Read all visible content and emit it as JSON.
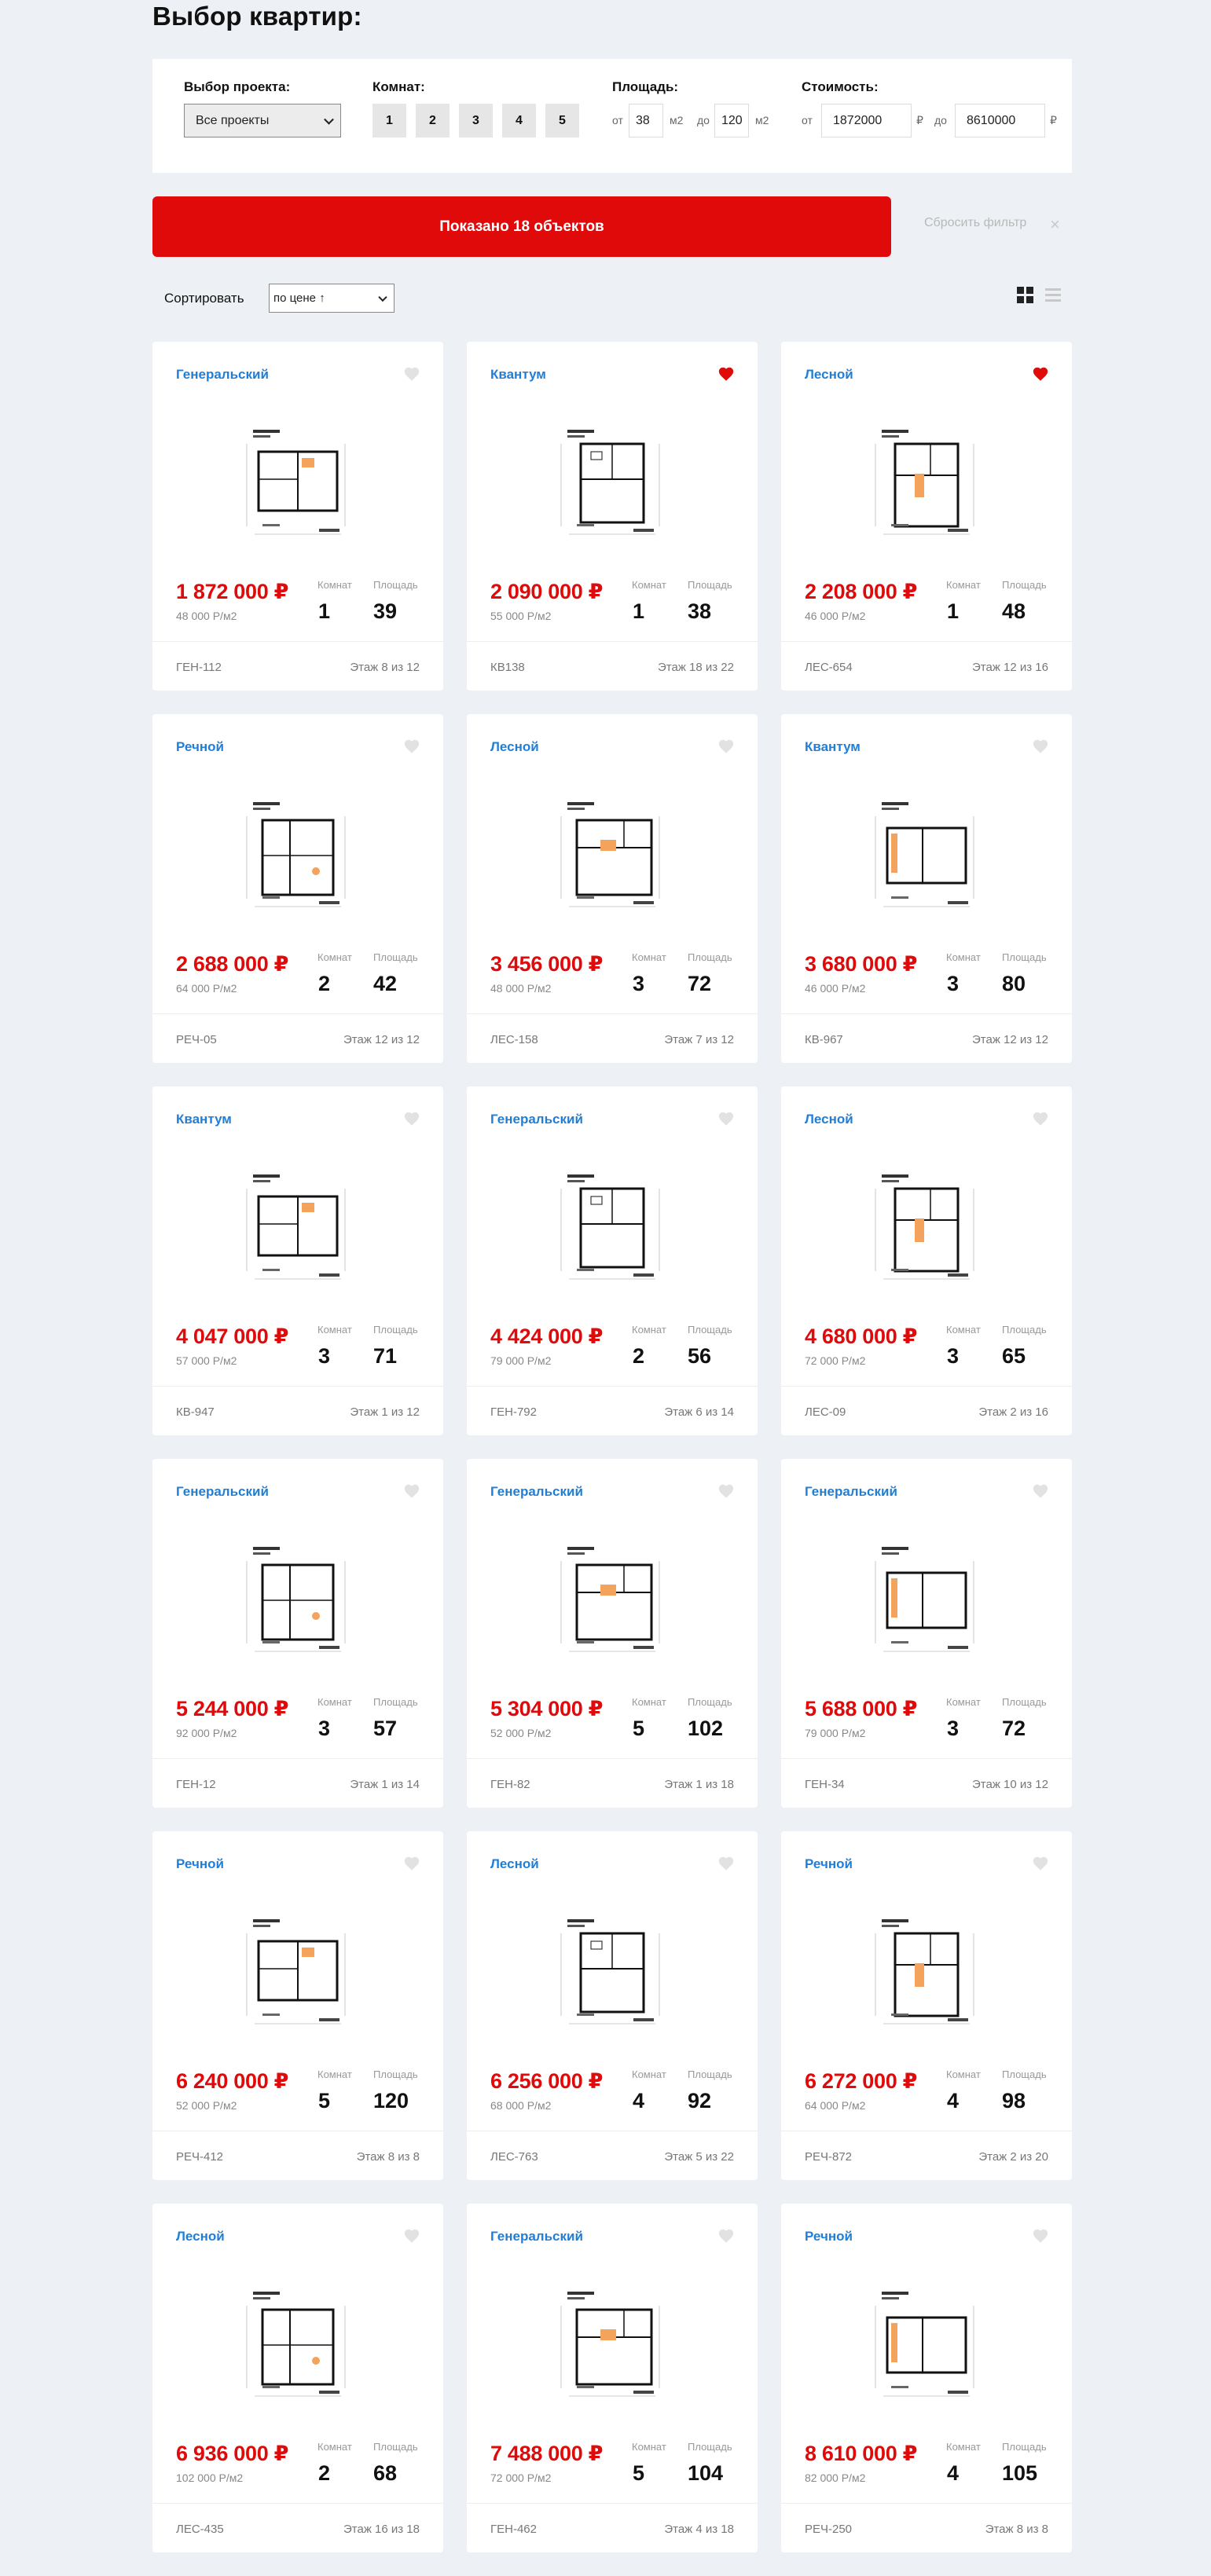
{
  "page": {
    "title": "Выбор квартир:"
  },
  "filters": {
    "project_label": "Выбор проекта:",
    "project_value": "Все проекты",
    "rooms_label": "Комнат:",
    "rooms": [
      "1",
      "2",
      "3",
      "4",
      "5"
    ],
    "area_label": "Площадь:",
    "area_from_lbl": "от",
    "area_from": "38",
    "area_unit1": "м2",
    "area_to_lbl": "до",
    "area_to": "120",
    "area_unit2": "м2",
    "price_label": "Стоимость:",
    "price_from_lbl": "от",
    "price_from": "1872000",
    "price_cur1": "₽",
    "price_to_lbl": "до",
    "price_to": "8610000",
    "price_cur2": "₽"
  },
  "results": {
    "label": "Показано 18 объектов",
    "reset_label": "Сбросить фильтр",
    "reset_icon": "×"
  },
  "sort": {
    "label": "Сортировать",
    "value": "по цене ↑"
  },
  "colors": {
    "accent": "#e00a0a",
    "project": "#1f7fd8",
    "heart_off": "#e2e2e2"
  },
  "card_labels": {
    "rooms": "Комнат",
    "area": "Площадь"
  },
  "cards": [
    {
      "project": "Генеральский",
      "fav": false,
      "price": "1 872 000 ₽",
      "ppm": "48 000 Р/м2",
      "rooms": "1",
      "area": "39",
      "code": "ГЕН-112",
      "floor": "Этаж 8 из 12"
    },
    {
      "project": "Квантум",
      "fav": true,
      "price": "2 090 000 ₽",
      "ppm": "55 000 Р/м2",
      "rooms": "1",
      "area": "38",
      "code": "КВ138",
      "floor": "Этаж 18 из 22"
    },
    {
      "project": "Лесной",
      "fav": true,
      "price": "2 208 000 ₽",
      "ppm": "46 000 Р/м2",
      "rooms": "1",
      "area": "48",
      "code": "ЛЕС-654",
      "floor": "Этаж 12 из 16"
    },
    {
      "project": "Речной",
      "fav": false,
      "price": "2 688 000 ₽",
      "ppm": "64 000 Р/м2",
      "rooms": "2",
      "area": "42",
      "code": "РЕЧ-05",
      "floor": "Этаж 12 из 12"
    },
    {
      "project": "Лесной",
      "fav": false,
      "price": "3 456 000 ₽",
      "ppm": "48 000 Р/м2",
      "rooms": "3",
      "area": "72",
      "code": "ЛЕС-158",
      "floor": "Этаж 7 из 12"
    },
    {
      "project": "Квантум",
      "fav": false,
      "price": "3 680 000 ₽",
      "ppm": "46 000 Р/м2",
      "rooms": "3",
      "area": "80",
      "code": "КВ-967",
      "floor": "Этаж 12 из 12"
    },
    {
      "project": "Квантум",
      "fav": false,
      "price": "4 047 000 ₽",
      "ppm": "57 000 Р/м2",
      "rooms": "3",
      "area": "71",
      "code": "КВ-947",
      "floor": "Этаж 1 из 12"
    },
    {
      "project": "Генеральский",
      "fav": false,
      "price": "4 424 000 ₽",
      "ppm": "79 000 Р/м2",
      "rooms": "2",
      "area": "56",
      "code": "ГЕН-792",
      "floor": "Этаж 6 из 14"
    },
    {
      "project": "Лесной",
      "fav": false,
      "price": "4 680 000 ₽",
      "ppm": "72 000 Р/м2",
      "rooms": "3",
      "area": "65",
      "code": "ЛЕС-09",
      "floor": "Этаж 2 из 16"
    },
    {
      "project": "Генеральский",
      "fav": false,
      "price": "5 244 000 ₽",
      "ppm": "92 000 Р/м2",
      "rooms": "3",
      "area": "57",
      "code": "ГЕН-12",
      "floor": "Этаж 1 из 14"
    },
    {
      "project": "Генеральский",
      "fav": false,
      "price": "5 304 000 ₽",
      "ppm": "52 000 Р/м2",
      "rooms": "5",
      "area": "102",
      "code": "ГЕН-82",
      "floor": "Этаж 1 из 18"
    },
    {
      "project": "Генеральский",
      "fav": false,
      "price": "5 688 000 ₽",
      "ppm": "79 000 Р/м2",
      "rooms": "3",
      "area": "72",
      "code": "ГЕН-34",
      "floor": "Этаж 10 из 12"
    },
    {
      "project": "Речной",
      "fav": false,
      "price": "6 240 000 ₽",
      "ppm": "52 000 Р/м2",
      "rooms": "5",
      "area": "120",
      "code": "РЕЧ-412",
      "floor": "Этаж 8 из 8"
    },
    {
      "project": "Лесной",
      "fav": false,
      "price": "6 256 000 ₽",
      "ppm": "68 000 Р/м2",
      "rooms": "4",
      "area": "92",
      "code": "ЛЕС-763",
      "floor": "Этаж 5 из 22"
    },
    {
      "project": "Речной",
      "fav": false,
      "price": "6 272 000 ₽",
      "ppm": "64 000 Р/м2",
      "rooms": "4",
      "area": "98",
      "code": "РЕЧ-872",
      "floor": "Этаж 2 из 20"
    },
    {
      "project": "Лесной",
      "fav": false,
      "price": "6 936 000 ₽",
      "ppm": "102 000 Р/м2",
      "rooms": "2",
      "area": "68",
      "code": "ЛЕС-435",
      "floor": "Этаж 16 из 18"
    },
    {
      "project": "Генеральский",
      "fav": false,
      "price": "7 488 000 ₽",
      "ppm": "72 000 Р/м2",
      "rooms": "5",
      "area": "104",
      "code": "ГЕН-462",
      "floor": "Этаж 4 из 18"
    },
    {
      "project": "Речной",
      "fav": false,
      "price": "8 610 000 ₽",
      "ppm": "82 000 Р/м2",
      "rooms": "4",
      "area": "105",
      "code": "РЕЧ-250",
      "floor": "Этаж 8 из 8"
    }
  ]
}
